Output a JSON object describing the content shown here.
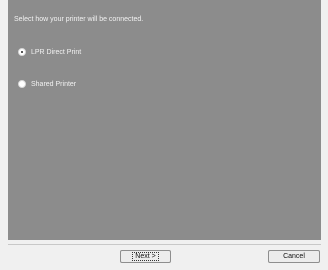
{
  "panel": {
    "prompt": "Select how your printer will be connected."
  },
  "options": [
    {
      "label": "LPR Direct Print",
      "selected": true
    },
    {
      "label": "Shared Printer",
      "selected": false
    }
  ],
  "buttons": {
    "next_label": "Next >",
    "cancel_label": "Cancel"
  },
  "colors": {
    "panel_bg": "#8c8c8c",
    "text": "#f2f2f2",
    "window_bg": "#f0f0f0"
  }
}
